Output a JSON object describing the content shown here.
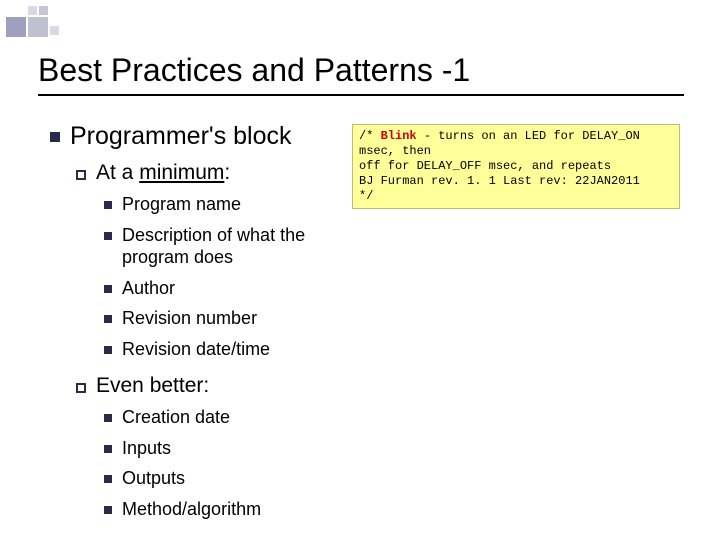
{
  "title": "Best Practices and Patterns -1",
  "main": {
    "heading": "Programmer's block",
    "section1": {
      "label_prefix": "At a ",
      "label_underlined": "minimum",
      "label_suffix": ":",
      "items": [
        "Program name",
        "Description of what the program does",
        "Author",
        "Revision number",
        "Revision date/time"
      ]
    },
    "section2": {
      "label": "Even better:",
      "items": [
        "Creation date",
        "Inputs",
        "Outputs",
        "Method/algorithm"
      ]
    }
  },
  "code": {
    "line1_prefix": "/* ",
    "line1_blink": "Blink",
    "line1_rest": "  -  turns on an LED for DELAY_ON msec, then",
    "line2": "off for DELAY_OFF msec, and repeats",
    "line3": "BJ Furman rev. 1. 1  Last rev: 22JAN2011",
    "line4": "*/"
  }
}
